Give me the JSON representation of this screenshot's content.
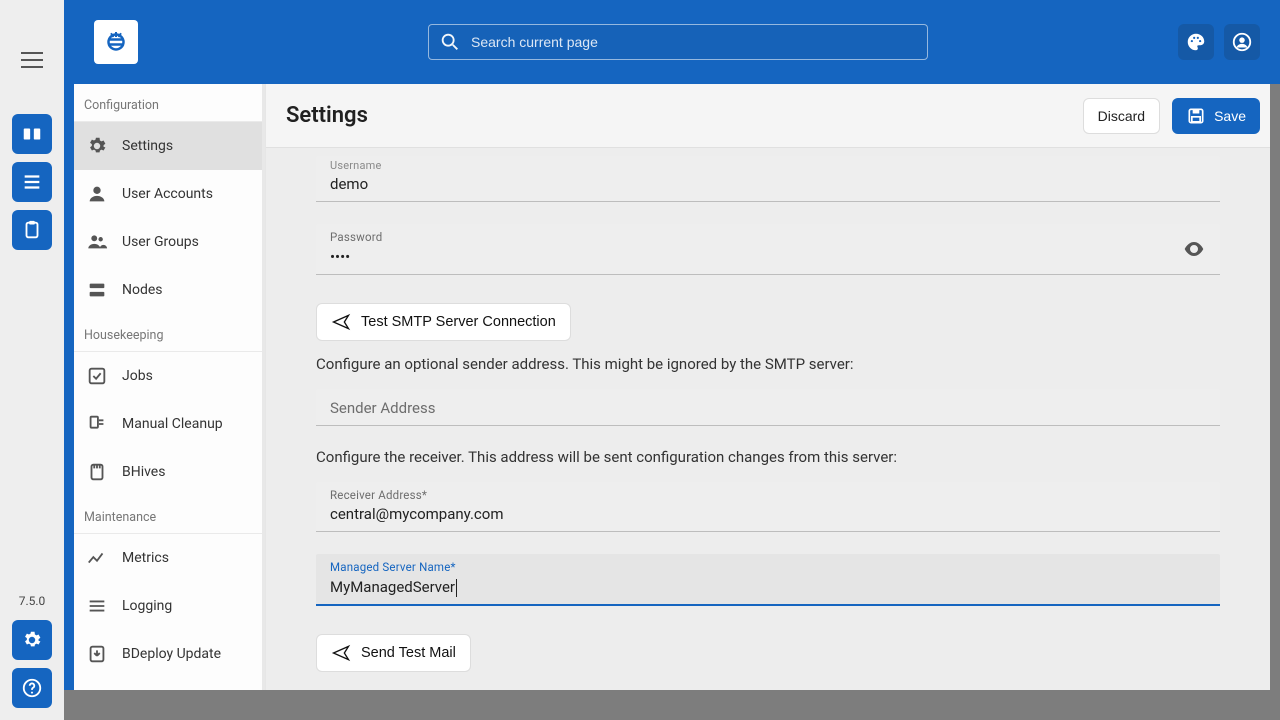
{
  "app": {
    "version": "7.5.0"
  },
  "topbar": {
    "search_placeholder": "Search current page"
  },
  "page": {
    "title": "Settings",
    "discard_label": "Discard",
    "save_label": "Save"
  },
  "sidebar": {
    "groups": [
      {
        "label": "Configuration",
        "items": [
          {
            "label": "Settings",
            "icon": "gear",
            "active": true
          },
          {
            "label": "User Accounts",
            "icon": "user"
          },
          {
            "label": "User Groups",
            "icon": "users"
          },
          {
            "label": "Nodes",
            "icon": "server"
          }
        ]
      },
      {
        "label": "Housekeeping",
        "items": [
          {
            "label": "Jobs",
            "icon": "check"
          },
          {
            "label": "Manual Cleanup",
            "icon": "broom"
          },
          {
            "label": "BHives",
            "icon": "sd"
          }
        ]
      },
      {
        "label": "Maintenance",
        "items": [
          {
            "label": "Metrics",
            "icon": "metrics"
          },
          {
            "label": "Logging",
            "icon": "lines"
          },
          {
            "label": "BDeploy Update",
            "icon": "download"
          }
        ]
      }
    ]
  },
  "form": {
    "username": {
      "label": "Username",
      "value": "demo"
    },
    "password": {
      "label": "Password",
      "value": "••••"
    },
    "test_conn_label": "Test SMTP Server Connection",
    "sender_help": "Configure an optional sender address. This might be ignored by the SMTP server:",
    "sender": {
      "label": "Sender Address",
      "value": ""
    },
    "receiver_help": "Configure the receiver. This address will be sent configuration changes from this server:",
    "receiver": {
      "label": "Receiver Address*",
      "value": "central@mycompany.com"
    },
    "managed": {
      "label": "Managed Server Name*",
      "value": "MyManagedServer"
    },
    "send_test_label": "Send Test Mail"
  }
}
